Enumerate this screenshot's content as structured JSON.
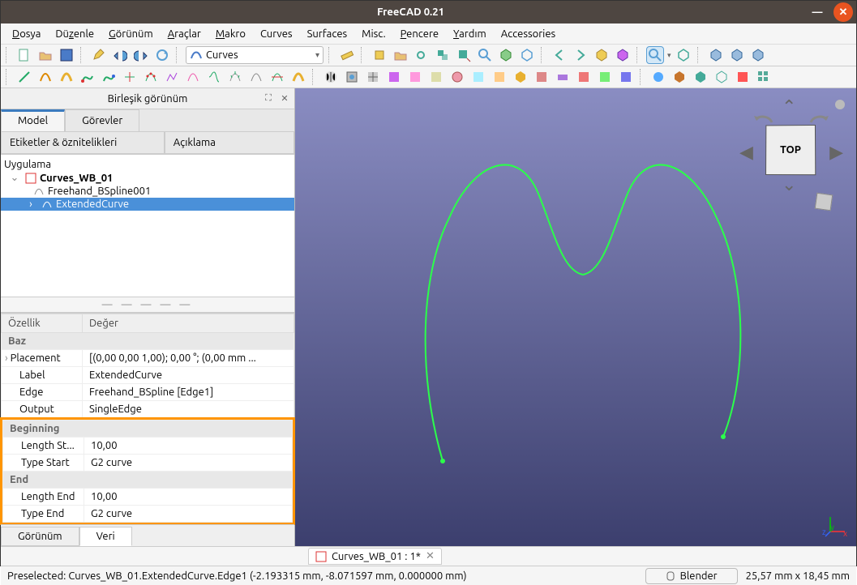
{
  "window": {
    "title": "FreeCAD 0.21"
  },
  "menu": [
    "Dosya",
    "Düzenle",
    "Görünüm",
    "Araçlar",
    "Makro",
    "Curves",
    "Surfaces",
    "Misc.",
    "Pencere",
    "Yardım",
    "Accessories"
  ],
  "workbench": {
    "label": "Curves"
  },
  "combo": {
    "title": "Birleşik görünüm"
  },
  "tabs": {
    "model": "Model",
    "tasks": "Görevler"
  },
  "subtabs": {
    "labels": "Etiketler & öznitelikleri",
    "desc": "Açıklama"
  },
  "tree": {
    "app": "Uygulama",
    "doc": "Curves_WB_01",
    "item1": "Freehand_BSpline001",
    "item2": "ExtendedCurve"
  },
  "propHeaders": {
    "prop": "Özellik",
    "val": "Değer"
  },
  "props": {
    "grpBase": "Baz",
    "placement": {
      "k": "Placement",
      "v": "[(0,00 0,00 1,00); 0,00 °; (0,00 mm ..."
    },
    "label": {
      "k": "Label",
      "v": "ExtendedCurve"
    },
    "edge": {
      "k": "Edge",
      "v": "Freehand_BSpline [Edge1]"
    },
    "output": {
      "k": "Output",
      "v": "SingleEdge"
    },
    "grpBeg": "Beginning",
    "lenStart": {
      "k": "Length St...",
      "v": "10,00"
    },
    "typStart": {
      "k": "Type Start",
      "v": "G2 curve"
    },
    "grpEnd": "End",
    "lenEnd": {
      "k": "Length End",
      "v": "10,00"
    },
    "typEnd": {
      "k": "Type End",
      "v": "G2 curve"
    }
  },
  "btabs": {
    "view": "Görünüm",
    "data": "Veri"
  },
  "doctab": "Curves_WB_01 : 1*",
  "status": {
    "presel": "Preselected: Curves_WB_01.ExtendedCurve.Edge1 (-2.193315 mm, -8.071597 mm, 0.000000 mm)",
    "nav": "Blender",
    "dims": "25,57 mm x 18,45 mm"
  },
  "navcube": {
    "face": "TOP"
  }
}
